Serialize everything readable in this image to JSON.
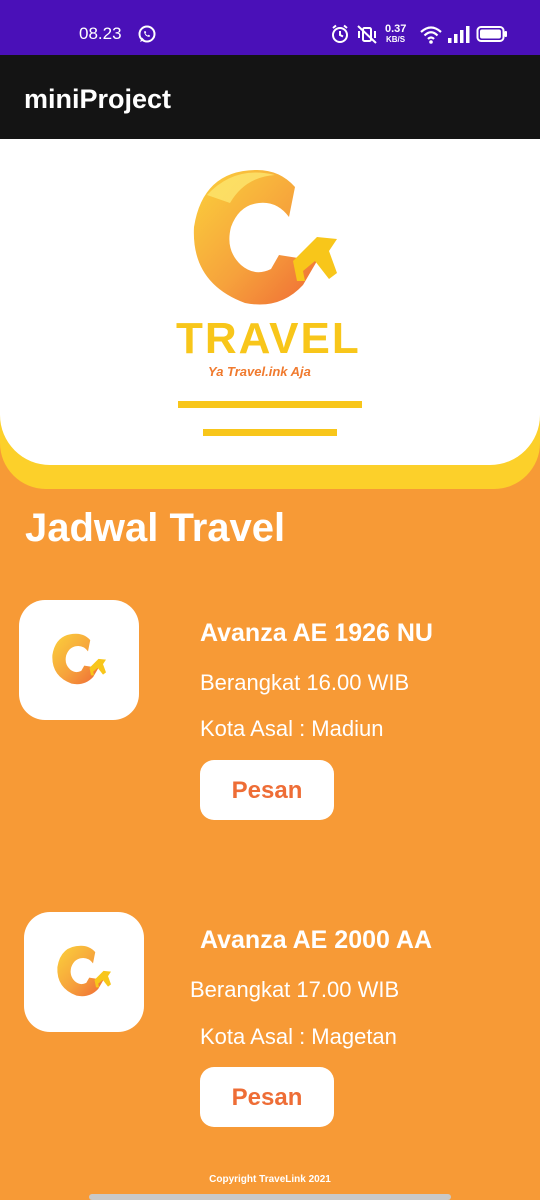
{
  "status_bar": {
    "time": "08.23",
    "speed_value": "0.37",
    "speed_unit": "KB/S",
    "battery_level": 0.95
  },
  "app_bar": {
    "title": "miniProject"
  },
  "logo": {
    "word": "TRAVEL",
    "tagline": "Ya Travel.ink Aja"
  },
  "section_title": "Jadwal Travel",
  "cards": [
    {
      "vehicle": "Avanza AE 1926 NU",
      "departure": "Berangkat 16.00 WIB",
      "origin": "Kota Asal : Madiun",
      "button_label": "Pesan"
    },
    {
      "vehicle": "Avanza AE 2000 AA",
      "departure": "Berangkat 17.00 WIB",
      "origin": "Kota Asal : Magetan",
      "button_label": "Pesan"
    }
  ],
  "footer": "Copyright TraveLink 2021",
  "colors": {
    "status_bar": "#4a10b8",
    "app_bar": "#141414",
    "background": "#f79a36",
    "accent_yellow": "#f8c61a",
    "button_text": "#ee6d36"
  }
}
